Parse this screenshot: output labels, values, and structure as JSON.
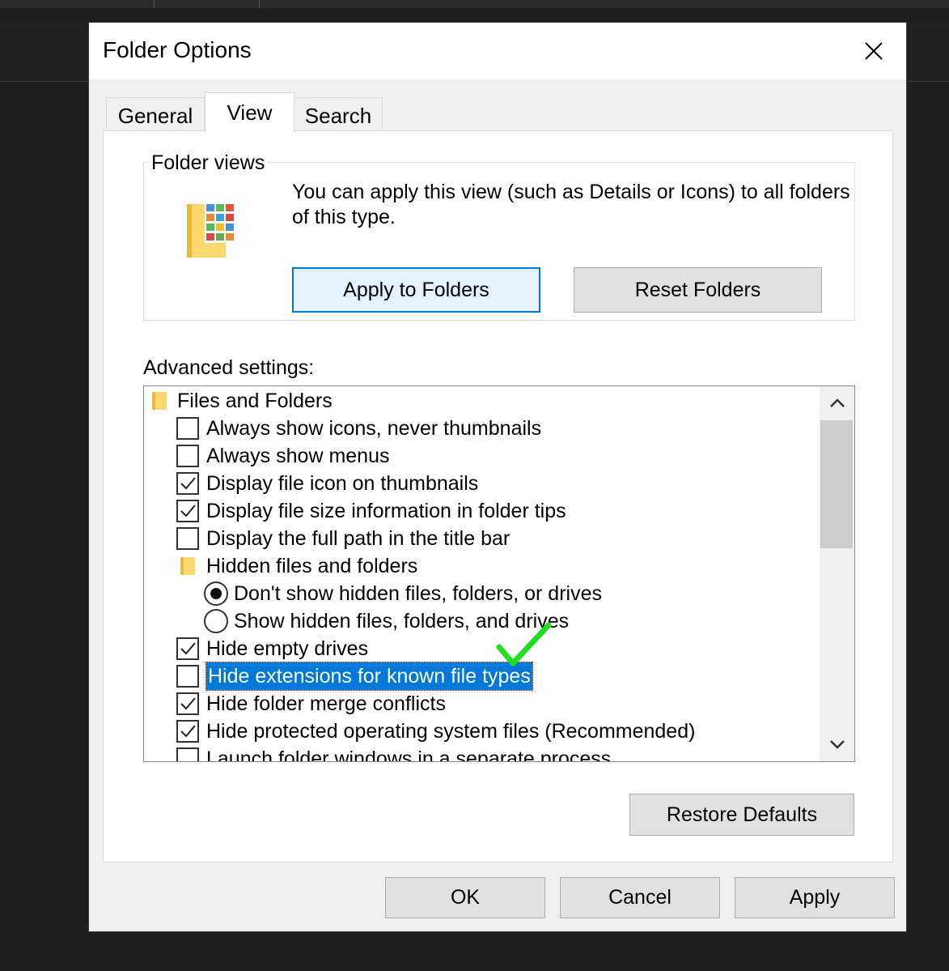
{
  "window": {
    "title": "Folder Options"
  },
  "tabs": [
    "General",
    "View",
    "Search"
  ],
  "active_tab": "View",
  "folder_views": {
    "label": "Folder views",
    "description": "You can apply this view (such as Details or Icons) to all folders of this type.",
    "apply_button": "Apply to Folders",
    "reset_button": "Reset Folders"
  },
  "advanced": {
    "label": "Advanced settings:",
    "items": [
      {
        "type": "folder",
        "text": "Files and Folders"
      },
      {
        "type": "checkbox",
        "text": "Always show icons, never thumbnails",
        "checked": false
      },
      {
        "type": "checkbox",
        "text": "Always show menus",
        "checked": false
      },
      {
        "type": "checkbox",
        "text": "Display file icon on thumbnails",
        "checked": true
      },
      {
        "type": "checkbox",
        "text": "Display file size information in folder tips",
        "checked": true
      },
      {
        "type": "checkbox",
        "text": "Display the full path in the title bar",
        "checked": false
      },
      {
        "type": "folder",
        "text": "Hidden files and folders"
      },
      {
        "type": "radio",
        "text": "Don't show hidden files, folders, or drives",
        "selected": true
      },
      {
        "type": "radio",
        "text": "Show hidden files, folders, and drives",
        "selected": false
      },
      {
        "type": "checkbox",
        "text": "Hide empty drives",
        "checked": true
      },
      {
        "type": "checkbox",
        "text": "Hide extensions for known file types",
        "checked": false,
        "highlighted": true
      },
      {
        "type": "checkbox",
        "text": "Hide folder merge conflicts",
        "checked": true
      },
      {
        "type": "checkbox",
        "text": "Hide protected operating system files (Recommended)",
        "checked": true
      },
      {
        "type": "checkbox",
        "text": "Launch folder windows in a separate process",
        "checked": false
      }
    ],
    "scroll_position": 0.0
  },
  "buttons": {
    "restore_defaults": "Restore Defaults",
    "ok": "OK",
    "cancel": "Cancel",
    "apply": "Apply"
  },
  "colors": {
    "selection": "#0078d7",
    "annotation_check": "#22dd22"
  },
  "icons": [
    "close-icon",
    "folder-views-icon",
    "folder-icon",
    "checkmark-icon",
    "radio-dot-icon",
    "scroll-up-icon",
    "scroll-down-icon",
    "annotation-checkmark-icon"
  ]
}
